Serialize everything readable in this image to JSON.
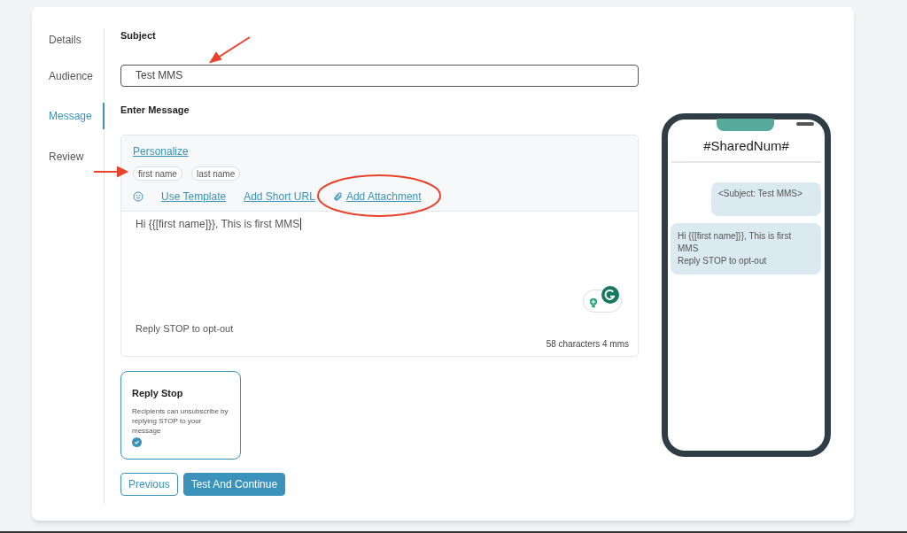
{
  "sidebar": {
    "items": [
      {
        "label": "Details",
        "selected": false
      },
      {
        "label": "Audience",
        "selected": false
      },
      {
        "label": "Message",
        "selected": true
      },
      {
        "label": "Review",
        "selected": false
      }
    ]
  },
  "subject": {
    "label": "Subject",
    "value": "Test MMS"
  },
  "message": {
    "label": "Enter Message",
    "personalize": "Personalize",
    "tags": [
      "first name",
      "last name"
    ],
    "tools": [
      {
        "kind": "template",
        "label": "Use Template"
      },
      {
        "kind": "url",
        "label": "Add Short URL"
      },
      {
        "kind": "attachment",
        "label": "Add Attachment"
      }
    ],
    "value": "Hi {{[first name]}}, This is first MMS",
    "footer": "Reply STOP to opt-out",
    "counter": "58 characters 4 mms"
  },
  "reply_stop": {
    "title": "Reply Stop",
    "description": "Recipients can unsubscribe by replying STOP to your message",
    "checked": true
  },
  "buttons": [
    {
      "kind": "outline",
      "label": "Previous"
    },
    {
      "kind": "primary",
      "label": "Test And Continue"
    }
  ],
  "preview": {
    "title": "#SharedNum#",
    "bubbles": [
      {
        "kind": "subject",
        "lines": [
          "<Subject: Test MMS>"
        ]
      },
      {
        "kind": "body",
        "lines": [
          "Hi {{[first name]}}, This is first MMS",
          "Reply STOP to opt-out"
        ]
      }
    ]
  }
}
